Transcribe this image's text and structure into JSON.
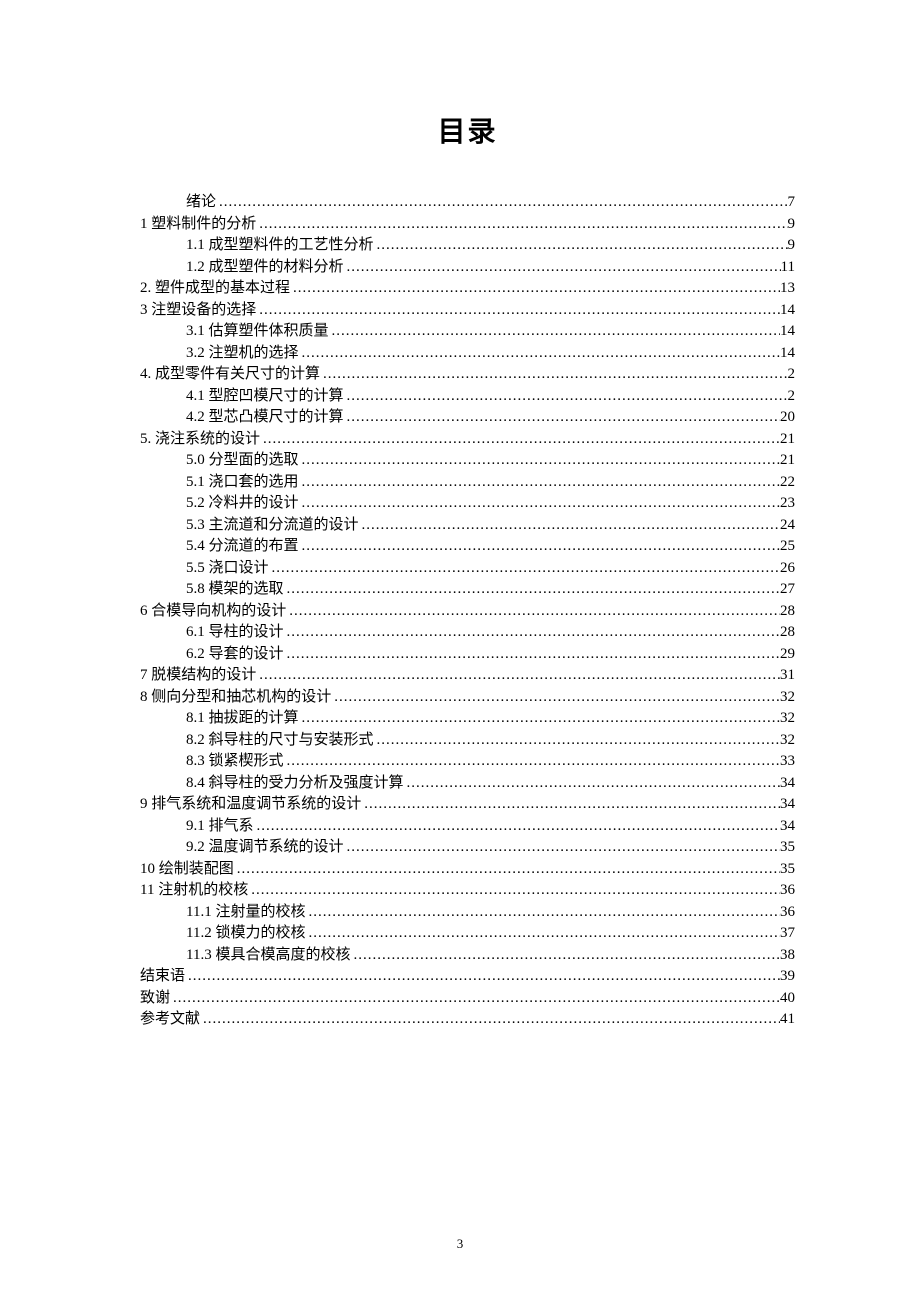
{
  "title": "目录",
  "page_number": "3",
  "entries": [
    {
      "level": 1,
      "label": "绪论",
      "page": "7"
    },
    {
      "level": 0,
      "label": "1   塑料制件的分析",
      "page": "9"
    },
    {
      "level": 1,
      "label": "1.1 成型塑料件的工艺性分析",
      "page": "9"
    },
    {
      "level": 1,
      "label": "1.2 成型塑件的材料分析",
      "page": "11"
    },
    {
      "level": 0,
      "label": "2.  塑件成型的基本过程",
      "page": "13"
    },
    {
      "level": 0,
      "label": "3  注塑设备的选择",
      "page": "14"
    },
    {
      "level": 1,
      "label": "3.1 估算塑件体积质量",
      "page": "14"
    },
    {
      "level": 1,
      "label": "3.2 注塑机的选择",
      "page": "14"
    },
    {
      "level": 0,
      "label": "4.  成型零件有关尺寸的计算",
      "page": "2"
    },
    {
      "level": 1,
      "label": "4.1 型腔凹模尺寸的计算",
      "page": "2"
    },
    {
      "level": 1,
      "label": "4.2 型芯凸模尺寸的计算",
      "page": "20"
    },
    {
      "level": 0,
      "label": "5.  浇注系统的设计",
      "page": "21"
    },
    {
      "level": 1,
      "label": "5.0 分型面的选取",
      "page": "21"
    },
    {
      "level": 1,
      "label": "5.1 浇口套的选用",
      "page": "22"
    },
    {
      "level": 1,
      "label": "5.2 冷料井的设计",
      "page": "23"
    },
    {
      "level": 1,
      "label": "5.3 主流道和分流道的设计",
      "page": "24"
    },
    {
      "level": 1,
      "label": "5.4 分流道的布置",
      "page": "25"
    },
    {
      "level": 1,
      "label": "5.5 浇口设计",
      "page": "26"
    },
    {
      "level": 1,
      "label": "5.8 模架的选取",
      "page": "27"
    },
    {
      "level": 0,
      "label": "6  合模导向机构的设计",
      "page": "28"
    },
    {
      "level": 1,
      "label": "6.1 导柱的设计",
      "page": "28"
    },
    {
      "level": 1,
      "label": "6.2 导套的设计",
      "page": "29"
    },
    {
      "level": 0,
      "label": "7  脱模结构的设计",
      "page": "31"
    },
    {
      "level": 0,
      "label": "8  侧向分型和抽芯机构的设计",
      "page": "32"
    },
    {
      "level": 1,
      "label": "8.1 抽拔距的计算",
      "page": "32"
    },
    {
      "level": 1,
      "label": "8.2 斜导柱的尺寸与安装形式",
      "page": "32"
    },
    {
      "level": 1,
      "label": "8.3  锁紧楔形式",
      "page": "33"
    },
    {
      "level": 1,
      "label": "8.4  斜导柱的受力分析及强度计算",
      "page": "34"
    },
    {
      "level": 0,
      "label": "9  排气系统和温度调节系统的设计",
      "page": "34"
    },
    {
      "level": 1,
      "label": "9.1 排气系",
      "page": "34"
    },
    {
      "level": 1,
      "label": "9.2 温度调节系统的设计",
      "page": "35"
    },
    {
      "level": 0,
      "label": "10  绘制装配图",
      "page": "35"
    },
    {
      "level": 0,
      "label": "11 注射机的校核",
      "page": "36"
    },
    {
      "level": 1,
      "label": "11.1  注射量的校核",
      "page": "36"
    },
    {
      "level": 1,
      "label": "11.2  锁模力的校核",
      "page": "37"
    },
    {
      "level": 1,
      "label": "11.3  模具合模高度的校核",
      "page": "38"
    },
    {
      "level": 0,
      "label": "结束语",
      "page": "39"
    },
    {
      "level": 0,
      "label": "致谢",
      "page": "40"
    },
    {
      "level": 0,
      "label": "参考文献",
      "page": "41"
    }
  ]
}
